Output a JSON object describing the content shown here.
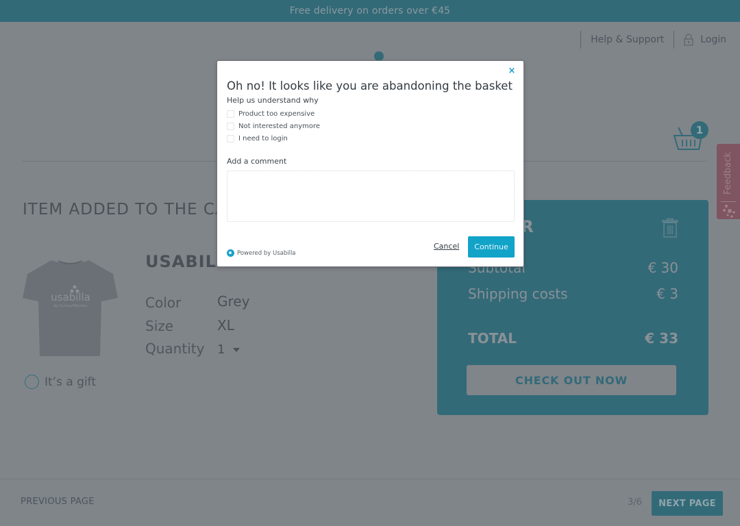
{
  "promo": {
    "text": "Free delivery on orders over €45"
  },
  "top_nav": {
    "help_label": "Help & Support",
    "login_label": "Login"
  },
  "cart": {
    "count": "1"
  },
  "feedback_tab": {
    "label": "Feedback"
  },
  "main": {
    "section_title": "ITEM ADDED TO THE CART",
    "product": {
      "name": "USABILLA",
      "image_brand": "usabilla",
      "image_tagline": "by SurveyMonkey",
      "specs": [
        {
          "label": "Color",
          "value": "Grey"
        },
        {
          "label": "Size",
          "value": "XL"
        },
        {
          "label": "Quantity",
          "value": "1"
        }
      ],
      "gift_label": "It’s a gift"
    }
  },
  "order": {
    "title": "ORDER",
    "rows": [
      {
        "label": "Subtotal",
        "value": "€ 30"
      },
      {
        "label": "Shipping costs",
        "value": "€ 3"
      }
    ],
    "total_label": "TOTAL",
    "total_value": "€ 33",
    "checkout_label": "CHECK OUT NOW"
  },
  "footer": {
    "prev_label": "PREVIOUS PAGE",
    "page_indicator": "3/6",
    "next_label": "NEXT PAGE"
  },
  "modal": {
    "close_symbol": "×",
    "title": "Oh no! It looks like you are abandoning the basket",
    "subtitle": "Help us understand why",
    "options": [
      {
        "label": "Product too expensive",
        "checked": false
      },
      {
        "label": "Not interested anymore",
        "checked": false
      },
      {
        "label": "I need to login",
        "checked": false
      }
    ],
    "comment_label": "Add a comment",
    "comment_value": "",
    "powered_by": "Powered by Usabilla",
    "cancel_label": "Cancel",
    "continue_label": "Continue",
    "accent_color": "#12a3c9"
  },
  "colors": {
    "brand_teal": "#336a78",
    "feedback_red": "#7e5560",
    "overlay_grey": "#80858a"
  }
}
